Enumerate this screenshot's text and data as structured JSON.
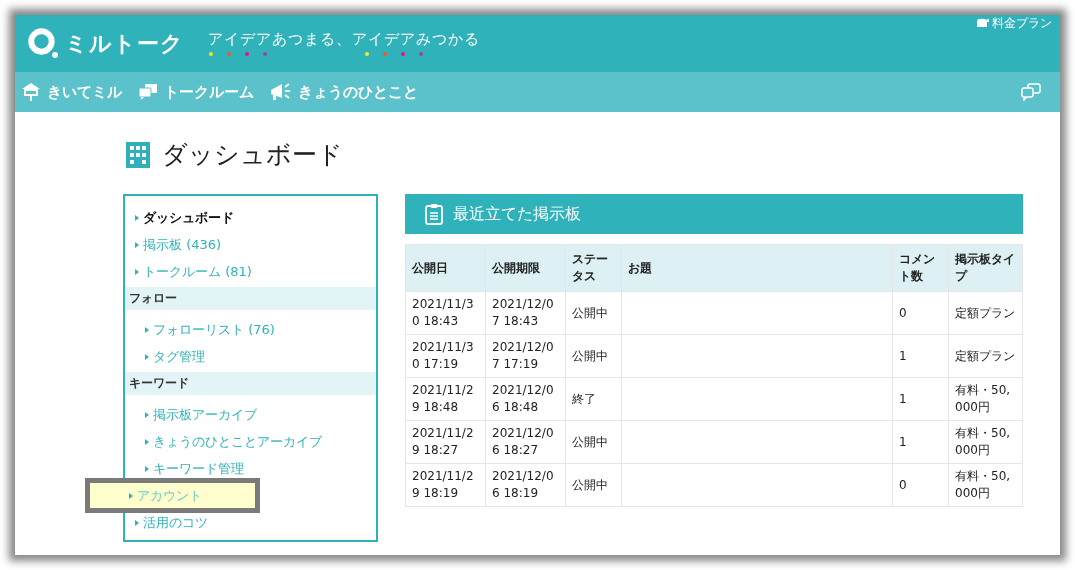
{
  "header": {
    "logo": "ミルトーク",
    "tagline": "アイデアあつまる、アイデアみつかる",
    "plan_link": "料金プラン"
  },
  "nav": [
    {
      "label": "きいてミル"
    },
    {
      "label": "トークルーム"
    },
    {
      "label": "きょうのひとこと"
    }
  ],
  "page_title": "ダッシュボード",
  "sidebar": [
    {
      "kind": "link",
      "label": "ダッシュボード",
      "selected": true,
      "highlighted": false
    },
    {
      "kind": "link",
      "label": "掲示板 (436)",
      "selected": false,
      "highlighted": false
    },
    {
      "kind": "link",
      "label": "トークルーム (81)",
      "selected": false,
      "highlighted": false
    },
    {
      "kind": "section",
      "label": "フォロー",
      "children": [
        {
          "label": "フォローリスト (76)",
          "selected": false
        },
        {
          "label": "タグ管理",
          "selected": false
        }
      ]
    },
    {
      "kind": "section",
      "label": "キーワード",
      "children": [
        {
          "label": "掲示板アーカイブ",
          "selected": false
        },
        {
          "label": "きょうのひとことアーカイブ",
          "selected": false
        },
        {
          "label": "キーワード管理",
          "selected": false
        }
      ]
    },
    {
      "kind": "link",
      "label": "アカウント",
      "selected": false,
      "highlighted": true
    },
    {
      "kind": "link",
      "label": "活用のコツ",
      "selected": false,
      "highlighted": false
    }
  ],
  "panel": {
    "title": "最近立てた掲示板",
    "columns": [
      "公開日",
      "公開期限",
      "ステータス",
      "お題",
      "コメント数",
      "掲示板タイプ"
    ],
    "rows": [
      [
        "2021/11/30 18:43",
        "2021/12/07 18:43",
        "公開中",
        "",
        "0",
        "定額プラン"
      ],
      [
        "2021/11/30 17:19",
        "2021/12/07 17:19",
        "公開中",
        "",
        "1",
        "定額プラン"
      ],
      [
        "2021/11/29 18:48",
        "2021/12/06 18:48",
        "終了",
        "",
        "1",
        "有料・50,000円"
      ],
      [
        "2021/11/29 18:27",
        "2021/12/06 18:27",
        "公開中",
        "",
        "1",
        "有料・50,000円"
      ],
      [
        "2021/11/29 18:19",
        "2021/12/06 18:19",
        "公開中",
        "",
        "0",
        "有料・50,000円"
      ]
    ]
  }
}
